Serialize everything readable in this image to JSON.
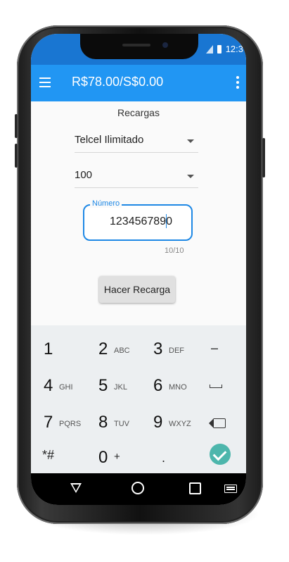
{
  "status_bar": {
    "time": "12:3"
  },
  "app_bar": {
    "title": "R$78.00/S$0.00"
  },
  "form": {
    "section_title": "Recargas",
    "operator_selected": "Telcel Ilimitado",
    "amount_selected": "100",
    "number_field": {
      "label": "Número",
      "value": "1234567890"
    },
    "char_counter": "10/10",
    "submit_label": "Hacer Recarga"
  },
  "keyboard": {
    "keys": [
      {
        "num": "1",
        "letters": ""
      },
      {
        "num": "2",
        "letters": "ABC"
      },
      {
        "num": "3",
        "letters": "DEF"
      },
      {
        "num": "4",
        "letters": "GHI"
      },
      {
        "num": "5",
        "letters": "JKL"
      },
      {
        "num": "6",
        "letters": "MNO"
      },
      {
        "num": "7",
        "letters": "PQRS"
      },
      {
        "num": "8",
        "letters": "TUV"
      },
      {
        "num": "9",
        "letters": "WXYZ"
      },
      {
        "num": "*#",
        "letters": ""
      },
      {
        "num": "0",
        "letters": "+"
      },
      {
        "num": ".",
        "letters": ""
      }
    ],
    "minus": "–",
    "space_icon": "space-icon",
    "backspace_icon": "backspace-icon",
    "done_icon": "check-icon"
  },
  "colors": {
    "app_bar": "#2196f3",
    "status_bar": "#1976d2",
    "accent": "#1e88e5",
    "done_key": "#4db6ac"
  }
}
